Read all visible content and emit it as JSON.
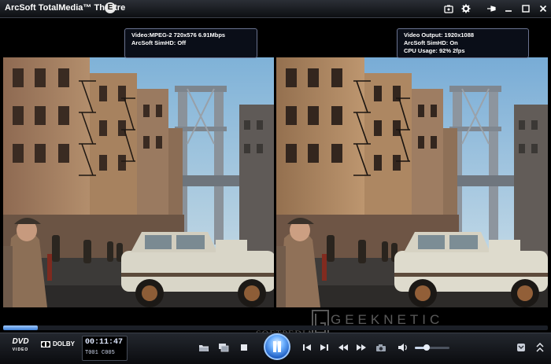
{
  "window": {
    "title": "ArcSoft  TotalMedia™ Theatre",
    "logo_letter": "E"
  },
  "titlebar_icons": [
    "media-library-icon",
    "gear-icon",
    "pin-icon",
    "minimize-icon",
    "maximize-icon",
    "close-icon"
  ],
  "overlay_left": {
    "line1": "Video:MPEG-2 720x576 6.91Mbps",
    "line2": "ArcSoft SimHD: Off"
  },
  "overlay_right": {
    "line1": "Video Output: 1920x1088",
    "line2": "ArcSoft SimHD: On",
    "line3": "CPU Usage: 92% 2fps"
  },
  "watermark": {
    "left_text": "SOFTPEDIA",
    "right_text": "GEEKNETIC"
  },
  "progress": {
    "fraction": 0.064
  },
  "status": {
    "dvd_label": "DVD",
    "dvd_sub": "VIDEO",
    "dolby_label": "DOLBY",
    "time": "00:11:47",
    "title_chapter": "T001 C005"
  },
  "controls": {
    "volume_fraction": 0.35
  },
  "colors": {
    "accent_blue": "#3d7fd6",
    "titlebar_dark": "#0d0f12"
  }
}
